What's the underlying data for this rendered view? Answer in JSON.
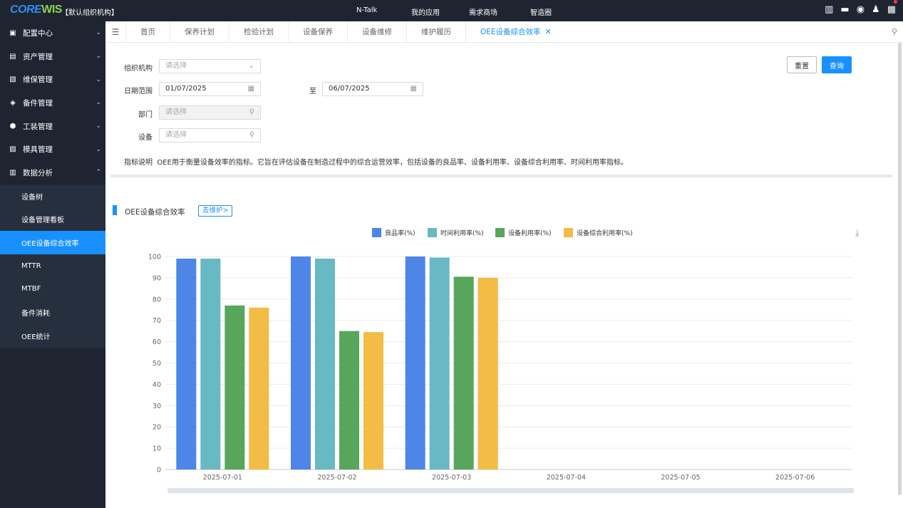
{
  "topbar": {
    "logo_text_a": "CORE",
    "logo_text_b": "WIS",
    "org": "【默认组织机构】",
    "nav": [
      "N-Talk",
      "我的应用",
      "需求商场",
      "智造圈"
    ]
  },
  "sidebar": {
    "items": [
      {
        "label": "配置中心",
        "icon": "config-icon"
      },
      {
        "label": "资产管理",
        "icon": "asset-icon"
      },
      {
        "label": "维保管理",
        "icon": "maintenance-icon"
      },
      {
        "label": "备件管理",
        "icon": "spare-parts-icon"
      },
      {
        "label": "工装管理",
        "icon": "tooling-icon"
      },
      {
        "label": "模具管理",
        "icon": "mold-icon"
      },
      {
        "label": "数据分析",
        "icon": "analytics-icon"
      }
    ],
    "subitems": [
      "设备树",
      "设备管理看板",
      "OEE设备综合效率",
      "MTTR",
      "MTBF",
      "备件消耗",
      "OEE统计"
    ]
  },
  "tabs": [
    "首页",
    "保养计划",
    "检验计划",
    "设备保养",
    "设备维修",
    "维护履历",
    "OEE设备综合效率"
  ],
  "form": {
    "org_label": "组织机构",
    "org_placeholder": "请选择",
    "date_label": "日期范围",
    "date_from": "01/07/2025",
    "date_to_label": "至",
    "date_to": "06/07/2025",
    "dept_label": "部门",
    "dept_placeholder": "请选择",
    "device_label": "设备",
    "device_placeholder": "请选择",
    "reset": "重置",
    "query": "查询",
    "note_label": "指标说明",
    "note_text": "OEE用于衡量设备效率的指标。它旨在评估设备在制造过程中的综合运营效率，包括设备的良品率、设备利用率、设备综合利用率、时间利用率指标。"
  },
  "chart_section": {
    "title": "OEE设备综合效率",
    "maint_button": "去维护>"
  },
  "chart_data": {
    "type": "bar",
    "categories": [
      "2025-07-01",
      "2025-07-02",
      "2025-07-03",
      "2025-07-04",
      "2025-07-05",
      "2025-07-06"
    ],
    "series": [
      {
        "name": "良品率(%)",
        "color": "#4e86e8",
        "values": [
          99,
          100,
          100,
          null,
          null,
          null
        ]
      },
      {
        "name": "时间利用率(%)",
        "color": "#68b9c3",
        "values": [
          99,
          99,
          99.5,
          null,
          null,
          null
        ]
      },
      {
        "name": "设备利用率(%)",
        "color": "#58a65c",
        "values": [
          77,
          65,
          90.5,
          null,
          null,
          null
        ]
      },
      {
        "name": "设备综合利用率(%)",
        "color": "#f2bc45",
        "values": [
          76,
          64.5,
          90,
          null,
          null,
          null
        ]
      }
    ],
    "y_ticks": [
      0,
      10,
      20,
      30,
      40,
      50,
      60,
      70,
      80,
      90,
      100
    ],
    "ylim": [
      0,
      100
    ],
    "legend_position": "top-center",
    "grid": true
  }
}
